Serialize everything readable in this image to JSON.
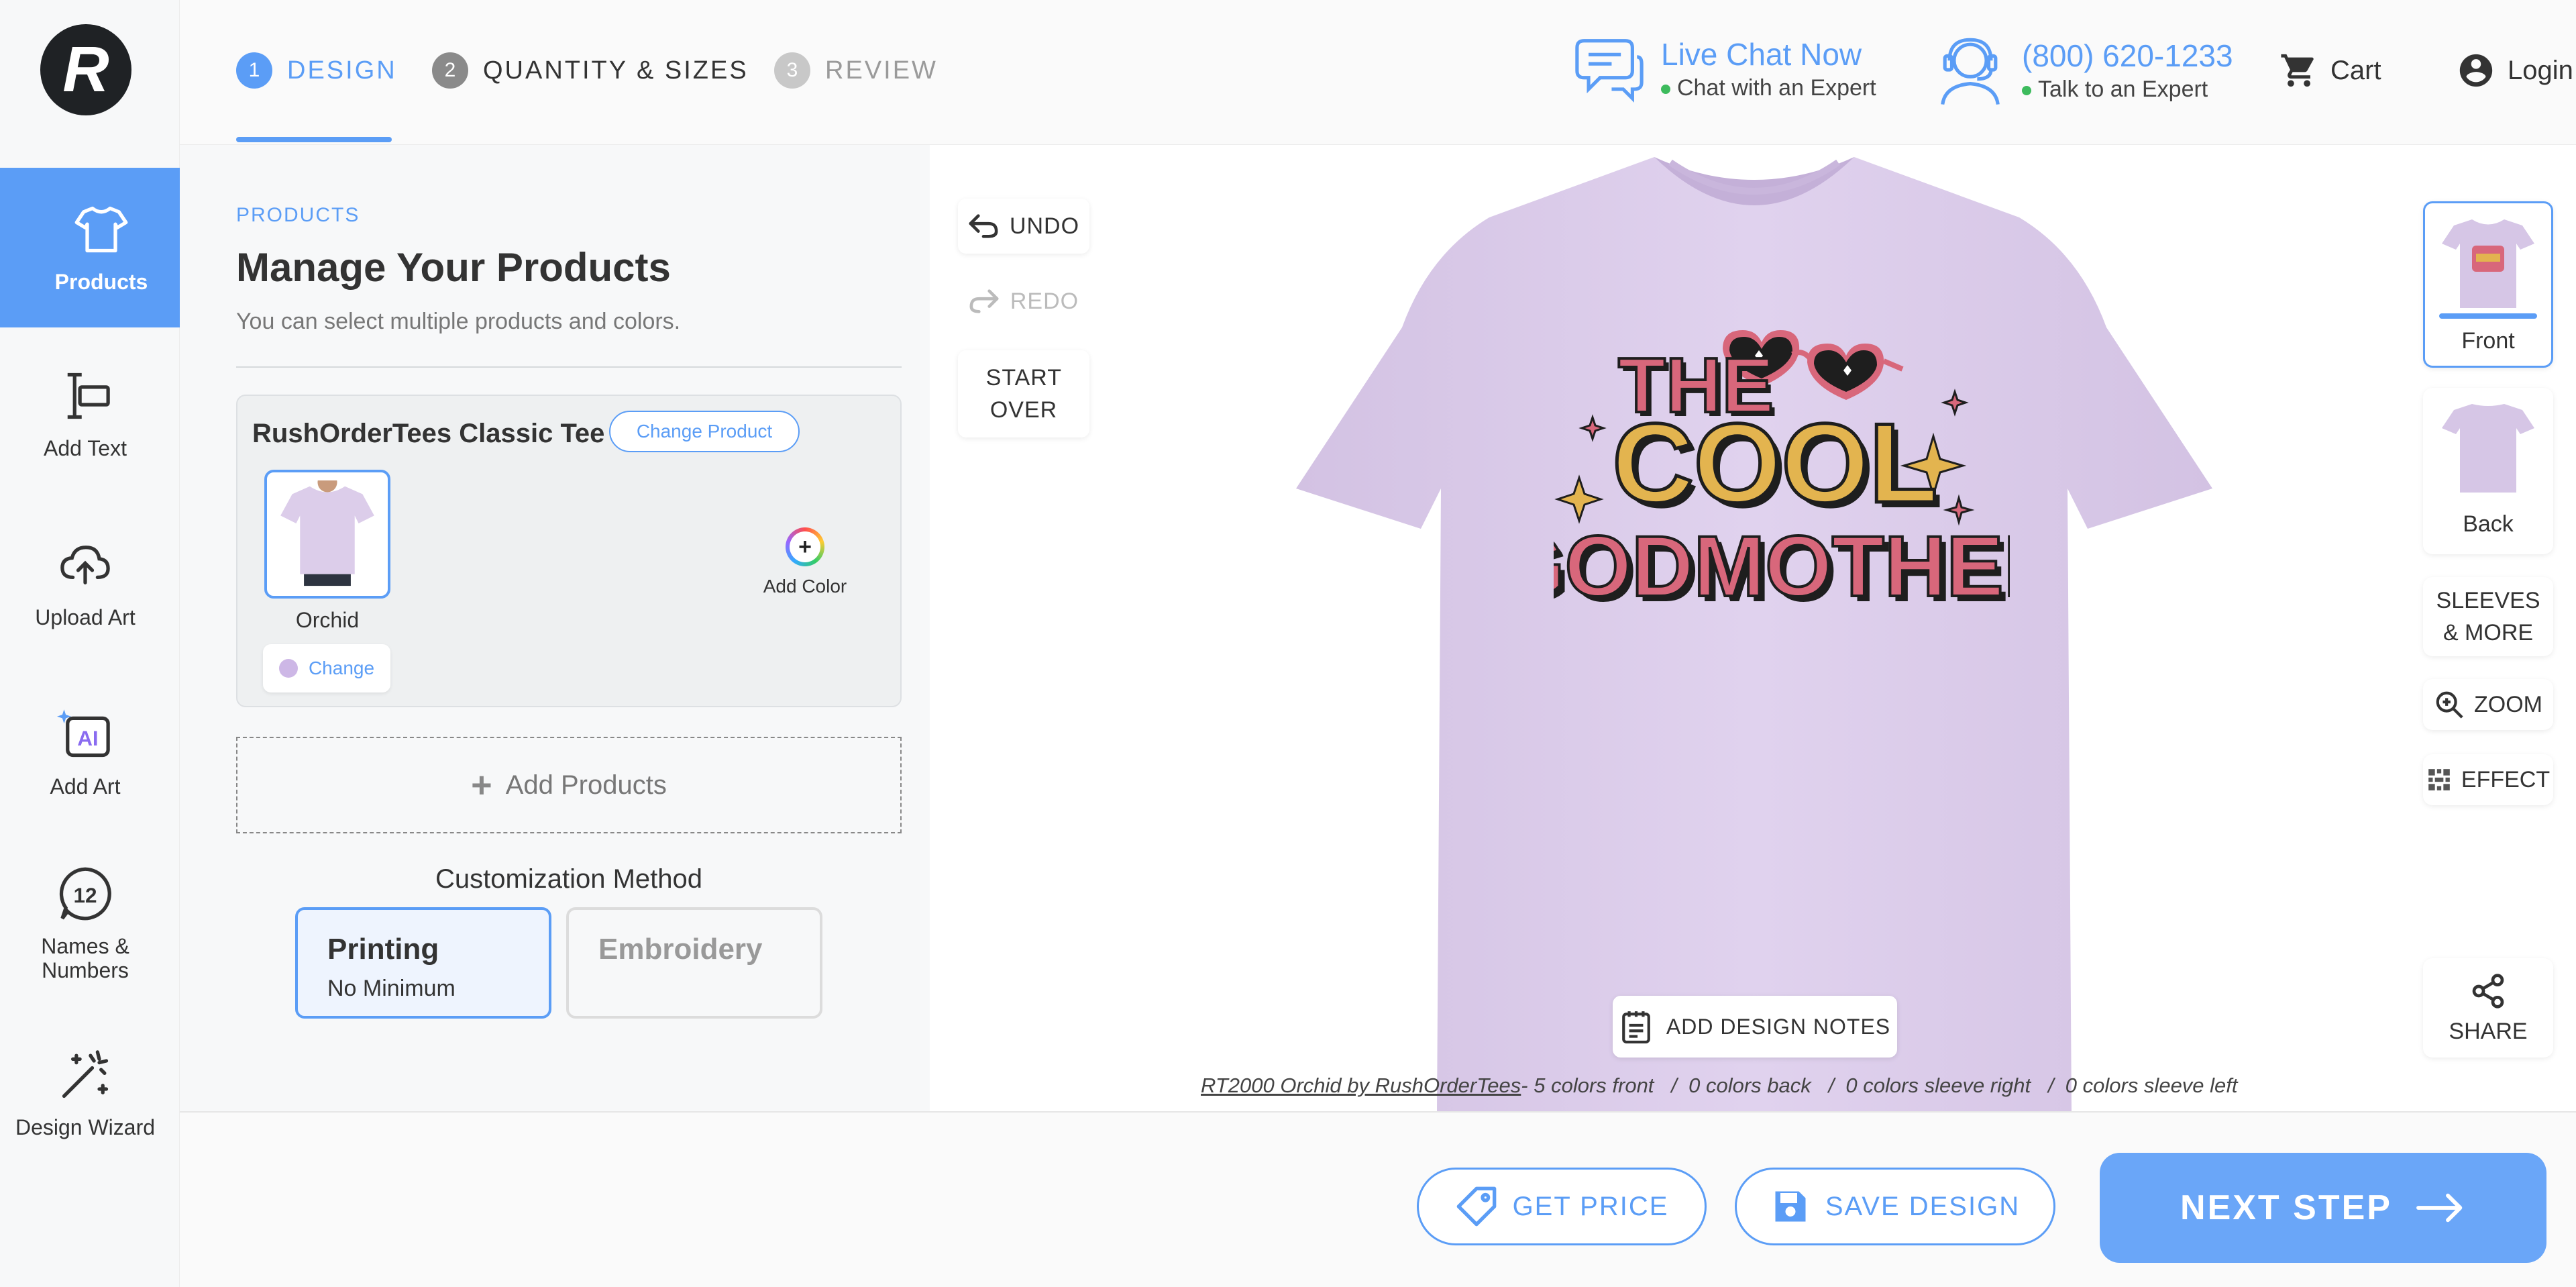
{
  "rail": {
    "items": [
      {
        "label": "Products"
      },
      {
        "label": "Add Text"
      },
      {
        "label": "Upload Art"
      },
      {
        "label": "Add Art"
      },
      {
        "label": "Names & Numbers"
      },
      {
        "label": "Design Wizard"
      }
    ]
  },
  "steps": [
    {
      "num": "1",
      "label": "DESIGN",
      "state": "active"
    },
    {
      "num": "2",
      "label": "QUANTITY & SIZES",
      "state": "next"
    },
    {
      "num": "3",
      "label": "REVIEW",
      "state": "disabled"
    }
  ],
  "header": {
    "chat_title": "Live Chat Now",
    "chat_sub": "Chat with an Expert",
    "phone_title": "(800) 620-1233",
    "phone_sub": "Talk to an Expert",
    "cart_label": "Cart",
    "login_label": "Login"
  },
  "products": {
    "crumb": "PRODUCTS",
    "title": "Manage Your Products",
    "subtitle": "You can select multiple products and colors.",
    "product_name": "RushOrderTees Classic Tee",
    "change_product_label": "Change Product",
    "color_name": "Orchid",
    "change_label": "Change",
    "add_color_label": "Add Color",
    "add_products_icon": "+",
    "add_products_label": "Add Products",
    "customization_label": "Customization Method",
    "methods": [
      {
        "title": "Printing",
        "subtitle": "No Minimum",
        "selected": true
      },
      {
        "title": "Embroidery",
        "subtitle": "",
        "selected": false
      }
    ],
    "swatch_color": "#cdb7e6"
  },
  "tools": {
    "undo": "UNDO",
    "redo": "REDO",
    "start_over": "START OVER"
  },
  "design": {
    "line1": "THE",
    "line2": "COOL",
    "line3": "GODMOTHER",
    "shirt_color": "#dccdea"
  },
  "design_notes_label": "ADD DESIGN NOTES",
  "caption": {
    "product_link": "RT2000 Orchid by RushOrderTees",
    "details": "- 5 colors front   /  0 colors back   /  0 colors sleeve right   /  0 colors sleeve left"
  },
  "views": {
    "front": "Front",
    "back": "Back",
    "sleeves": "SLEEVES & MORE",
    "zoom": "ZOOM",
    "effect": "EFFECT",
    "share": "SHARE"
  },
  "bottom": {
    "get_price": "GET PRICE",
    "save_design": "SAVE DESIGN",
    "next_step": "NEXT STEP"
  },
  "colors": {
    "accent": "#5b9df6",
    "status_online": "#3dbb5d"
  }
}
